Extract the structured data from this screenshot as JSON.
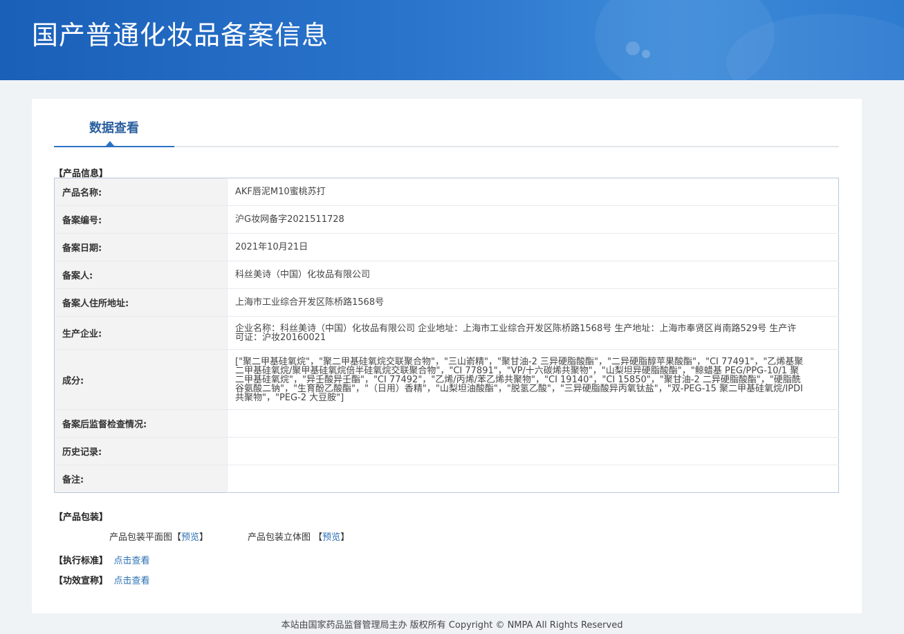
{
  "header": {
    "title": "国产普通化妆品备案信息"
  },
  "tabs": [
    {
      "label": "数据查看",
      "active": true
    }
  ],
  "product_info": {
    "section_label": "【产品信息】",
    "rows": [
      {
        "label": "产品名称:",
        "value": "AKF唇泥M10蜜桃苏打"
      },
      {
        "label": "备案编号:",
        "value": "沪G妆网备字2021511728"
      },
      {
        "label": "备案日期:",
        "value": "2021年10月21日"
      },
      {
        "label": "备案人:",
        "value": "科丝美诗（中国）化妆品有限公司"
      },
      {
        "label": "备案人住所地址:",
        "value": "上海市工业综合开发区陈桥路1568号"
      },
      {
        "label": "生产企业:",
        "value": "企业名称：科丝美诗（中国）化妆品有限公司 企业地址：上海市工业综合开发区陈桥路1568号 生产地址：上海市奉贤区肖南路529号 生产许可证：沪妆20160021"
      },
      {
        "label": "成分:",
        "value": "[\"聚二甲基硅氧烷\"，\"聚二甲基硅氧烷交联聚合物\"，\"三山嵛精\"，\"聚甘油-2 三异硬脂酸酯\"，\"二异硬脂醇苹果酸酯\"，\"CI 77491\"，\"乙烯基聚二甲基硅氧烷/聚甲基硅氧烷倍半硅氧烷交联聚合物\"，\"CI 77891\"，\"VP/十六碳烯共聚物\"，\"山梨坦异硬脂酸酯\"，\"鲸蜡基 PEG/PPG-10/1 聚二甲基硅氧烷\"，\"异壬酸异壬酯\"，\"CI 77492\"，\"乙烯/丙烯/苯乙烯共聚物\"，\"CI 19140\"，\"CI 15850\"，\"聚甘油-2 二异硬脂酸酯\"，\"硬脂酰谷氨酸二钠\"，\"生育酚乙酸酯\"，\"（日用）香精\"，\"山梨坦油酸酯\"，\"脱氢乙酸\"，\"三异硬脂酸异丙氧钛盐\"，\"双-PEG-15 聚二甲基硅氧烷/IPDI 共聚物\"，\"PEG-2 大豆胺\"]"
      },
      {
        "label": "备案后监督检查情况:",
        "value": ""
      },
      {
        "label": "历史记录:",
        "value": ""
      },
      {
        "label": "备注:",
        "value": ""
      }
    ]
  },
  "packaging": {
    "section_label": "【产品包装】",
    "flat_label": "产品包装平面图",
    "flat_link": "预览",
    "three_d_label": "产品包装立体图",
    "three_d_link": "预览",
    "bracket_open": "【",
    "bracket_close": "】"
  },
  "standard": {
    "label": "【执行标准】",
    "link": "点击查看"
  },
  "efficacy": {
    "label": "【功效宣称】",
    "link": "点击查看"
  },
  "footer": {
    "text": "本站由国家药品监督管理局主办 版权所有 Copyright © NMPA All Rights Reserved"
  }
}
